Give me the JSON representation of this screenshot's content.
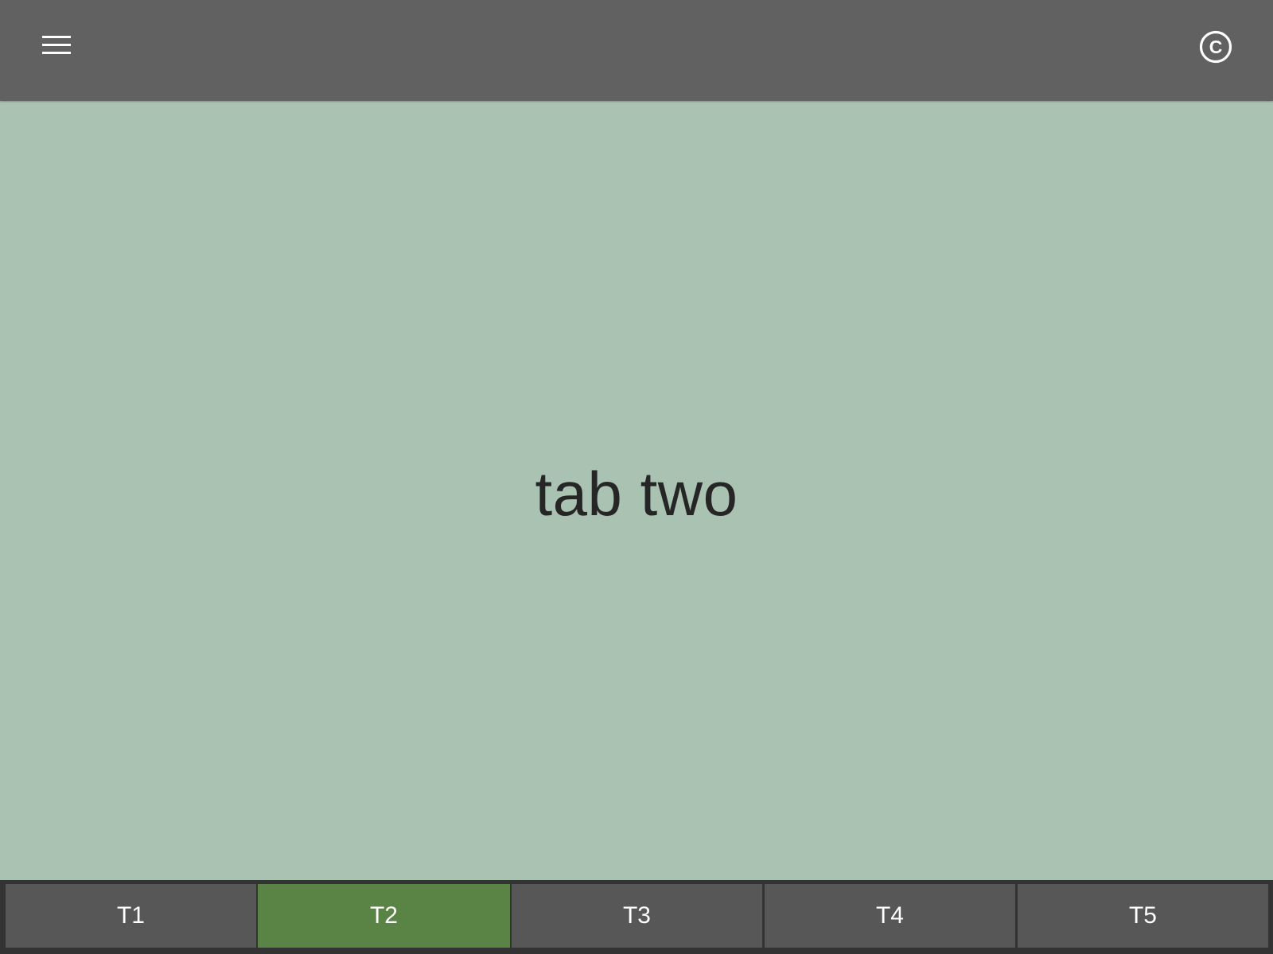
{
  "header": {
    "menu_icon": "hamburger-menu-icon",
    "right_icon": "copyright-icon",
    "right_icon_glyph": "C"
  },
  "content": {
    "title": "tab two"
  },
  "tabs": [
    {
      "label": "T1",
      "active": false
    },
    {
      "label": "T2",
      "active": true
    },
    {
      "label": "T3",
      "active": false
    },
    {
      "label": "T4",
      "active": false
    },
    {
      "label": "T5",
      "active": false
    }
  ],
  "colors": {
    "header_bg": "#616161",
    "content_bg": "#aac2b1",
    "tabbar_bg": "#333333",
    "tab_bg": "#575757",
    "tab_active_bg": "#5a8446",
    "text_dark": "#262626",
    "text_light": "#ffffff"
  }
}
